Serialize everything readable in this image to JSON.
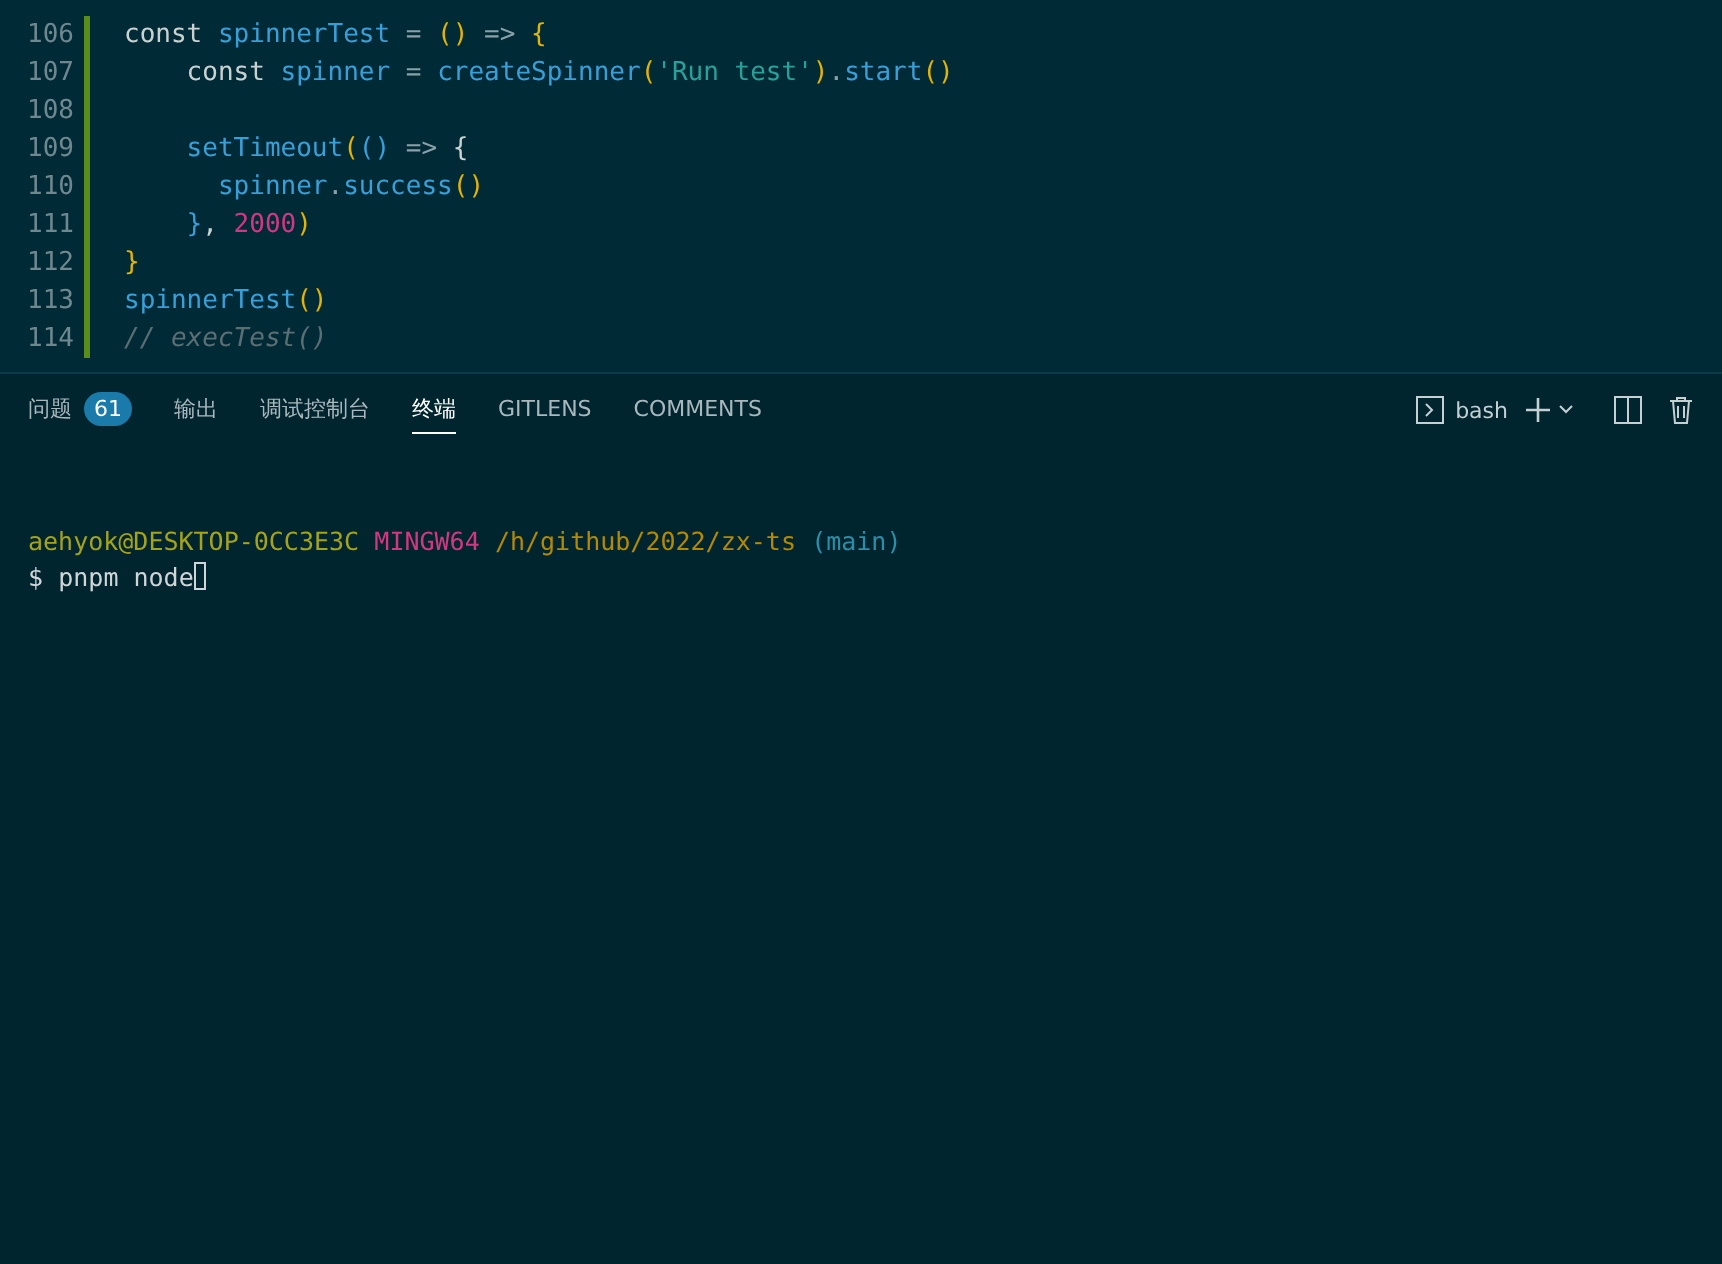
{
  "editor": {
    "lines": [
      {
        "number": "106",
        "tokens": [
          {
            "kind": "keyword",
            "text": "const "
          },
          {
            "kind": "name",
            "text": "spinnerTest"
          },
          {
            "kind": "op",
            "text": " = "
          },
          {
            "kind": "bracket",
            "text": "()"
          },
          {
            "kind": "op",
            "text": " => "
          },
          {
            "kind": "bracket",
            "text": "{"
          }
        ]
      },
      {
        "number": "107",
        "tokens": [
          {
            "kind": "keyword",
            "text": "    const "
          },
          {
            "kind": "name",
            "text": "spinner"
          },
          {
            "kind": "op",
            "text": " = "
          },
          {
            "kind": "name",
            "text": "createSpinner"
          },
          {
            "kind": "bracket",
            "text": "("
          },
          {
            "kind": "string",
            "text": "'Run test'"
          },
          {
            "kind": "bracket",
            "text": ")"
          },
          {
            "kind": "op",
            "text": "."
          },
          {
            "kind": "name",
            "text": "start"
          },
          {
            "kind": "bracket",
            "text": "()"
          }
        ]
      },
      {
        "number": "108"
      },
      {
        "number": "109",
        "tokens": [
          {
            "kind": "name",
            "text": "    setTimeout"
          },
          {
            "kind": "bracket",
            "text": "("
          },
          {
            "kind": "name",
            "text": "()"
          },
          {
            "kind": "op",
            "text": " => "
          },
          {
            "kind": "punct",
            "text": "{"
          }
        ]
      },
      {
        "number": "110",
        "tokens": [
          {
            "kind": "name",
            "text": "      spinner"
          },
          {
            "kind": "op",
            "text": "."
          },
          {
            "kind": "name",
            "text": "success"
          },
          {
            "kind": "bracket",
            "text": "()"
          }
        ]
      },
      {
        "number": "111",
        "tokens": [
          {
            "kind": "name",
            "text": "    }"
          },
          {
            "kind": "punct",
            "text": ", "
          },
          {
            "kind": "number",
            "text": "2000"
          },
          {
            "kind": "bracket",
            "text": ")"
          }
        ]
      },
      {
        "number": "112",
        "tokens": [
          {
            "kind": "bracket",
            "text": "}"
          }
        ]
      },
      {
        "number": "113",
        "tokens": [
          {
            "kind": "name",
            "text": "spinnerTest"
          },
          {
            "kind": "bracket",
            "text": "()"
          }
        ]
      },
      {
        "number": "114",
        "tokens": [
          {
            "kind": "comment",
            "text": "// execTest()"
          }
        ]
      }
    ]
  },
  "panel": {
    "tabs": [
      {
        "label": "问题",
        "badge": "61",
        "selected": false
      },
      {
        "label": "输出",
        "selected": false
      },
      {
        "label": "调试控制台",
        "selected": false
      },
      {
        "label": "终端",
        "selected": true
      },
      {
        "label": "GITLENS",
        "selected": false
      },
      {
        "label": "COMMENTS",
        "selected": false
      }
    ],
    "shell": "bash"
  },
  "terminal": {
    "lines": [
      {
        "kind": "prompt",
        "parts": [
          {
            "kind": "user",
            "text": "aehyok@DESKTOP-0CC3E3C"
          },
          {
            "kind": "system",
            "text": "MINGW64"
          },
          {
            "kind": "path",
            "text": "/h/github/2022/zx-ts"
          },
          {
            "kind": "branch",
            "text": "(main)"
          }
        ]
      },
      {
        "kind": "command",
        "parts": [
          {
            "kind": "dollar",
            "text": "$"
          },
          {
            "kind": "input",
            "text": "pnpm node"
          }
        ]
      }
    ]
  }
}
